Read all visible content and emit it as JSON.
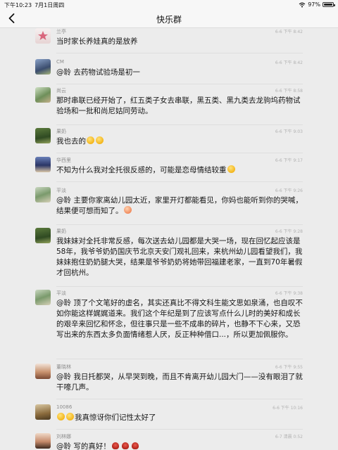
{
  "status_bar": {
    "time": "下午10:23",
    "date": "7月1日周四",
    "battery": "97%",
    "battery_level": 0.97
  },
  "nav": {
    "title": "快乐群"
  },
  "messages": [
    {
      "sender": "兰亭",
      "time": "6-6 下午 8:42",
      "text": "当时家长养娃真的是放养"
    },
    {
      "sender": "CM",
      "time": "6-6 下午 8:42",
      "text": "@聆 去药物试验场是初一"
    },
    {
      "sender": "尚云",
      "time": "6-6 下午 8:58",
      "text": "那时串联已经开始了，红五类子女去串联，黑五类、黑九类去龙驹坞药物试验场和一批和尚尼姑同劳动。"
    },
    {
      "sender": "果奶",
      "time": "6-6 下午 9:03",
      "text": "我也去的"
    },
    {
      "sender": "华西里",
      "time": "6-6 下午 9:17",
      "text": "不知为什么我对全托很反感的，可能是恋母情结较重"
    },
    {
      "sender": "平淡",
      "time": "6-6 下午 9:26",
      "text": "@聆 主要你家离幼儿园太近，家里开灯都能看见，你妈也能听到你的哭喊，结果便可想而知了。"
    },
    {
      "sender": "果奶",
      "time": "6-6 下午 9:28",
      "text": "我妹妹对全托非常反感，每次送去幼儿园都是大哭一场，现在回忆起应该是58年，我爷爷奶奶国庆节北京天安门观礼回来，来杭州幼儿园看望我们，我妹妹抱住奶奶腿大哭，结果是爷爷奶奶将她带回福建老家，一直到70年暑假才回杭州。"
    },
    {
      "sender": "平淡",
      "time": "6-6 下午 9:38",
      "text": "@聆 顶了个文笔好的虚名，其实还真比不得文科生能文思如泉涌，也自叹不如你能这样娓娓道来。我们这个年纪是到了应该写点什么儿时的美好和成长的艰辛来回忆和怀念，但往事只是一些不成串的碎片，也静不下心来，又恐写出来的东西太多负面情绪惹人厌，反正种种借口...，所以更加佩服你。"
    },
    {
      "sender": "董晓林",
      "time": "6-6 下午 9:55",
      "text": "@聆 我日托都哭，从早哭到晚，而且不肯离开幼儿园大门——没有眼泪了就干嚎几声。"
    },
    {
      "sender": "10086",
      "time": "6-6 下午 10:16",
      "text": "我真惊讶你们记性太好了"
    },
    {
      "sender": "刘林娜",
      "time": "6-7 清晨 0:52",
      "text": "@聆 写的真好！"
    }
  ]
}
